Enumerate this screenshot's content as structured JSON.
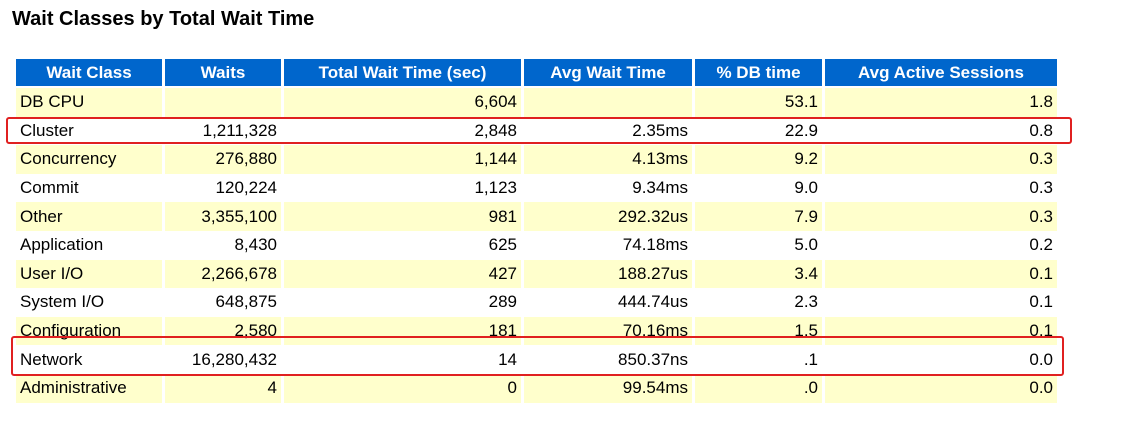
{
  "title": "Wait Classes by Total Wait Time",
  "headers": [
    "Wait Class",
    "Waits",
    "Total Wait Time (sec)",
    "Avg Wait Time",
    "% DB time",
    "Avg Active Sessions"
  ],
  "rows": [
    [
      "DB CPU",
      "",
      "6,604",
      "",
      "53.1",
      "1.8"
    ],
    [
      "Cluster",
      "1,211,328",
      "2,848",
      "2.35ms",
      "22.9",
      "0.8"
    ],
    [
      "Concurrency",
      "276,880",
      "1,144",
      "4.13ms",
      "9.2",
      "0.3"
    ],
    [
      "Commit",
      "120,224",
      "1,123",
      "9.34ms",
      "9.0",
      "0.3"
    ],
    [
      "Other",
      "3,355,100",
      "981",
      "292.32us",
      "7.9",
      "0.3"
    ],
    [
      "Application",
      "8,430",
      "625",
      "74.18ms",
      "5.0",
      "0.2"
    ],
    [
      "User I/O",
      "2,266,678",
      "427",
      "188.27us",
      "3.4",
      "0.1"
    ],
    [
      "System I/O",
      "648,875",
      "289",
      "444.74us",
      "2.3",
      "0.1"
    ],
    [
      "Configuration",
      "2,580",
      "181",
      "70.16ms",
      "1.5",
      "0.1"
    ],
    [
      "Network",
      "16,280,432",
      "14",
      "850.37ns",
      ".1",
      "0.0"
    ],
    [
      "Administrative",
      "4",
      "0",
      "99.54ms",
      ".0",
      "0.0"
    ]
  ],
  "highlight_color": "#e02020",
  "header_color": "#0066cc",
  "stripe_color": "#ffffcc"
}
